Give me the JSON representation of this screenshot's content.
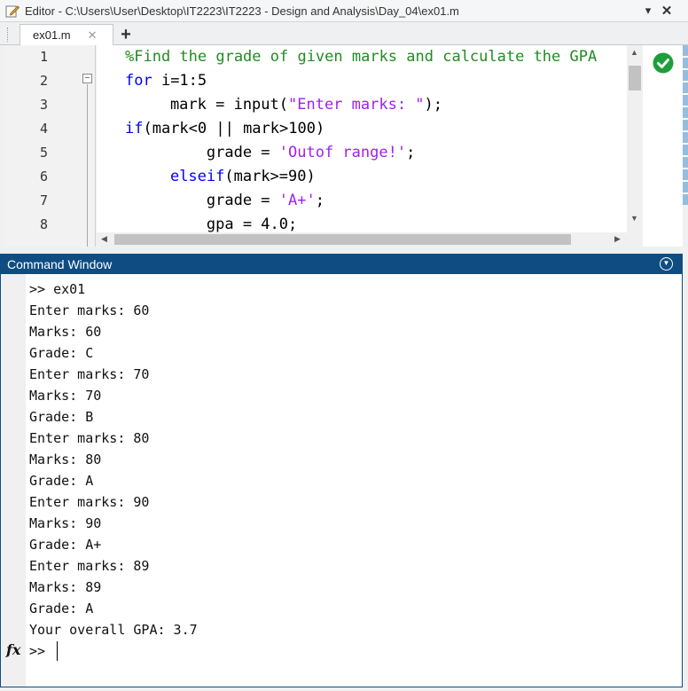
{
  "titlebar": {
    "title": "Editor - C:\\Users\\User\\Desktop\\IT2223\\IT2223 - Design and Analysis\\Day_04\\ex01.m",
    "menu_glyph": "▾",
    "close_glyph": "✕"
  },
  "tabs": {
    "active_label": "ex01.m",
    "close_glyph": "✕",
    "add_glyph": "+"
  },
  "editor": {
    "line_numbers": [
      "1",
      "2",
      "3",
      "4",
      "5",
      "6",
      "7",
      "8"
    ],
    "fold_glyph": "−",
    "lines": [
      [
        {
          "t": "%Find the grade of given marks and calculate the GPA",
          "c": "cmt"
        }
      ],
      [
        {
          "t": "for",
          "c": "kw"
        },
        {
          "t": " i=1:5",
          "c": ""
        }
      ],
      [
        {
          "t": "    mark = input(",
          "c": ""
        },
        {
          "t": "\"Enter marks: \"",
          "c": "str"
        },
        {
          "t": ");",
          "c": ""
        }
      ],
      [
        {
          "t": "if",
          "c": "kw"
        },
        {
          "t": "(mark<0 || mark>100)",
          "c": ""
        }
      ],
      [
        {
          "t": "        grade = ",
          "c": ""
        },
        {
          "t": "'Outof range!'",
          "c": "str"
        },
        {
          "t": ";",
          "c": ""
        }
      ],
      [
        {
          "t": "    ",
          "c": ""
        },
        {
          "t": "elseif",
          "c": "kw"
        },
        {
          "t": "(mark>=90)",
          "c": ""
        }
      ],
      [
        {
          "t": "        grade = ",
          "c": ""
        },
        {
          "t": "'A+'",
          "c": "str"
        },
        {
          "t": ";",
          "c": ""
        }
      ],
      [
        {
          "t": "        gpa = 4.0;",
          "c": ""
        }
      ]
    ],
    "analyzer_status": "ok",
    "colors": {
      "keyword": "#0000ff",
      "string": "#a020f0",
      "comment": "#228b22",
      "check": "#1e9e3a"
    }
  },
  "command_window": {
    "title": "Command Window",
    "output": [
      ">> ex01",
      "Enter marks: 60",
      "Marks: 60",
      "Grade: C",
      "Enter marks: 70",
      "Marks: 70",
      "Grade: B",
      "Enter marks: 80",
      "Marks: 80",
      "Grade: A",
      "Enter marks: 90",
      "Marks: 90",
      "Grade: A+",
      "Enter marks: 89",
      "Marks: 89",
      "Grade: A",
      "Your overall GPA: 3.7"
    ],
    "prompt": ">>",
    "fx_label": "fx",
    "header_color": "#0f4c81"
  }
}
